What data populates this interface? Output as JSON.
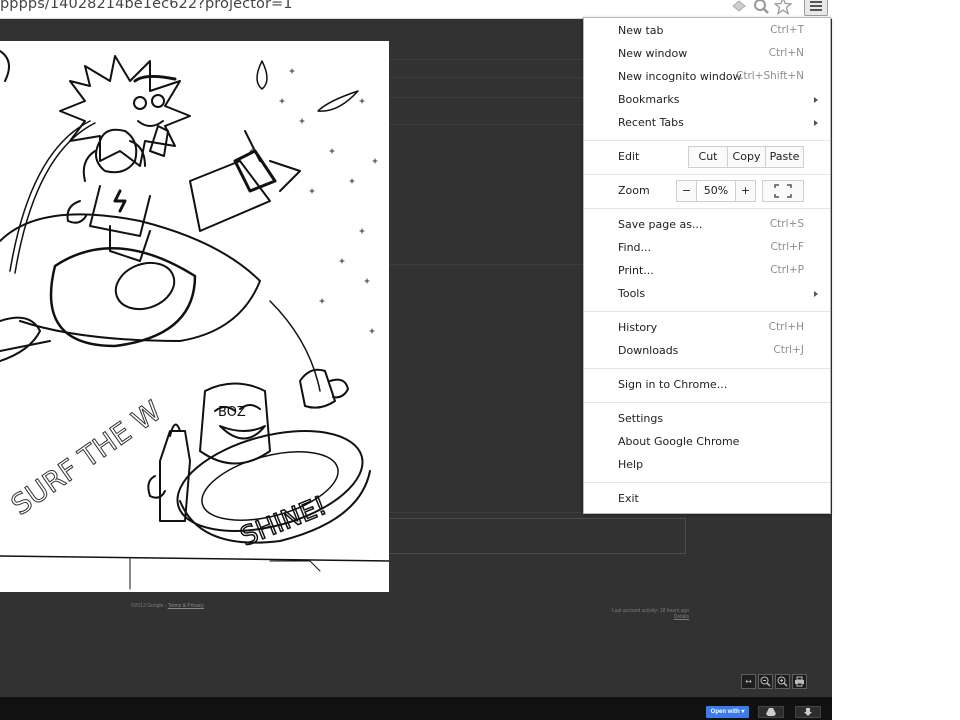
{
  "browser": {
    "url_text": "pppps/14028214be1ec622?projector=1",
    "icons": [
      "extension-icon",
      "search-icon",
      "star-icon",
      "menu-icon"
    ]
  },
  "page": {
    "footer_left_text": "©2013 Google - ",
    "footer_left_link": "Terms & Privacy",
    "footer_right_line1": "Last account activity: 18 hours ago",
    "footer_right_line2": "Details"
  },
  "drawing": {
    "description_icon": "hand-drawn-sketch-image",
    "lettering_1": "SURF THE W",
    "lettering_2": "SHINE!",
    "lettering_3": "BOZ"
  },
  "viewer_toolbar": {
    "icons": [
      "fit-width-icon",
      "zoom-out-icon",
      "zoom-in-icon",
      "print-icon"
    ]
  },
  "bottom_bar": {
    "open_with_label": "Open with ▾",
    "icons": [
      "drive-icon",
      "download-icon"
    ]
  },
  "menu": {
    "new_tab": {
      "label": "New tab",
      "shortcut": "Ctrl+T"
    },
    "new_window": {
      "label": "New window",
      "shortcut": "Ctrl+N"
    },
    "new_incognito": {
      "label": "New incognito window",
      "shortcut": "Ctrl+Shift+N"
    },
    "bookmarks": {
      "label": "Bookmarks"
    },
    "recent_tabs": {
      "label": "Recent Tabs"
    },
    "edit": {
      "label": "Edit",
      "cut": "Cut",
      "copy": "Copy",
      "paste": "Paste"
    },
    "zoom": {
      "label": "Zoom",
      "minus": "−",
      "value": "50%",
      "plus": "+"
    },
    "save_page": {
      "label": "Save page as...",
      "shortcut": "Ctrl+S"
    },
    "find": {
      "label": "Find...",
      "shortcut": "Ctrl+F"
    },
    "print": {
      "label": "Print...",
      "shortcut": "Ctrl+P"
    },
    "tools": {
      "label": "Tools"
    },
    "history": {
      "label": "History",
      "shortcut": "Ctrl+H"
    },
    "downloads": {
      "label": "Downloads",
      "shortcut": "Ctrl+J"
    },
    "sign_in": {
      "label": "Sign in to Chrome..."
    },
    "settings": {
      "label": "Settings"
    },
    "about": {
      "label": "About Google Chrome"
    },
    "help": {
      "label": "Help"
    },
    "exit": {
      "label": "Exit"
    }
  }
}
